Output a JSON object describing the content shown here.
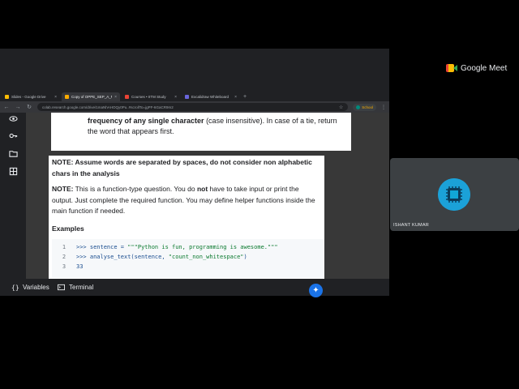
{
  "meet": {
    "title": "Google Meet"
  },
  "browser": {
    "tabs": [
      {
        "label": "Slides - Google Drive",
        "favicon_color": "#fbbc04",
        "active": false
      },
      {
        "label": "Copy of OPPE_SEP_A_MAS",
        "favicon_color": "#f9ab00",
        "active": true
      },
      {
        "label": "Courses • IITM Study",
        "favicon_color": "#ea4335",
        "active": false
      },
      {
        "label": "Excalidraw Whiteboard",
        "favicon_color": "#6965db",
        "active": false
      }
    ],
    "new_tab": "+",
    "url": "colab.research.google.com/drive/1maNhAHOQy0Pu..#scrollTo=jgPF-6GaCR9m2",
    "profile_label": "School"
  },
  "problem": {
    "top_bold": "frequency of any single character",
    "top_rest": " (case insensitive). In case of a tie, return the word that appears first.",
    "note1": "NOTE: Assume words are separated by spaces, do not consider non alphabetic chars in the analysis",
    "note2_label": "NOTE:",
    "note2_a": " This is a function-type question. You do ",
    "note2_not": "not",
    "note2_b": " have to take input or print the output. Just complete the required function. You may define helper functions inside the main function if needed.",
    "examples_heading": "Examples",
    "code": [
      {
        "num": "1",
        "prefix": ">>> sentence = ",
        "str": "\"\"\"Python is fun, programming is awesome.\"\"\"",
        "suffix": ""
      },
      {
        "num": "2",
        "prefix": ">>> analyse_text(sentence, ",
        "str": "\"count_non_whitespace\"",
        "suffix": ")"
      },
      {
        "num": "3",
        "prefix": "33",
        "str": "",
        "suffix": ""
      }
    ]
  },
  "bottom": {
    "variables_label": "Variables",
    "terminal_label": "Terminal"
  },
  "participant": {
    "name": "ISHANT KUMAR",
    "avatar_color": "#1ba1d8"
  }
}
